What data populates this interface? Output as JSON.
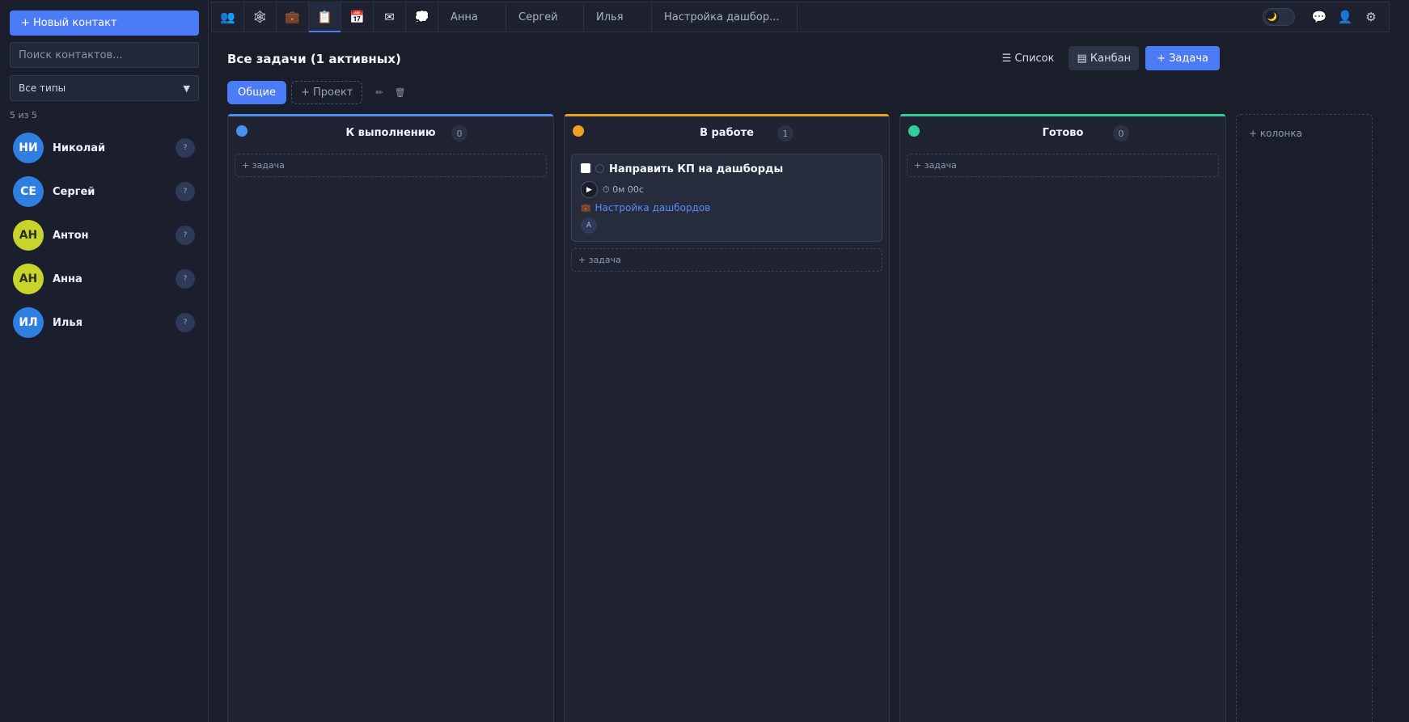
{
  "sidebar": {
    "new_contact_label": "+ Новый контакт",
    "search_placeholder": "Поиск контактов...",
    "type_filter": "Все типы",
    "count_text": "5 из 5",
    "contacts": [
      {
        "initials": "НИ",
        "name": "Николай",
        "badge": "?",
        "color": "#2f7fe0"
      },
      {
        "initials": "СЕ",
        "name": "Сергей",
        "badge": "?",
        "color": "#2f7fe0"
      },
      {
        "initials": "АН",
        "name": "Антон",
        "badge": "?",
        "color": "#c8d42a"
      },
      {
        "initials": "АН",
        "name": "Анна",
        "badge": "?",
        "color": "#c8d42a"
      },
      {
        "initials": "ИЛ",
        "name": "Илья",
        "badge": "?",
        "color": "#2f7fe0"
      }
    ]
  },
  "topbar": {
    "icons": [
      "👥",
      "🕸",
      "💼",
      "📋",
      "📅",
      "✉",
      "💭"
    ],
    "tabs": [
      "Анна",
      "Сергей",
      "Илья",
      "Настройка дашбор..."
    ],
    "theme_icon": "🌙",
    "chat_icon": "💬",
    "user_icon": "👤",
    "settings_icon": "⚙"
  },
  "main": {
    "title": "Все задачи (1 активных)",
    "view_list": "☰ Список",
    "view_kanban": "▤ Канбан",
    "add_task": "+ Задача",
    "tab_general": "Общие",
    "tab_add_project": "+ Проект",
    "edit_icon": "✏",
    "delete_icon": "🗑"
  },
  "board": {
    "columns": [
      {
        "title": "К выполнению",
        "count": "0",
        "color": "#4a90f0",
        "add_label": "+ задача"
      },
      {
        "title": "В работе",
        "count": "1",
        "color": "#f0a020",
        "add_label": "+ задача"
      },
      {
        "title": "Готово",
        "count": "0",
        "color": "#2ecf9a",
        "add_label": "+ задача"
      }
    ],
    "add_column_label": "+ колонка",
    "card": {
      "title": "Направить КП на дашборды",
      "timer": "⏱ 0м 00с",
      "project_icon": "💼",
      "project": "Настройка дашбордов",
      "assignee": "А"
    }
  }
}
